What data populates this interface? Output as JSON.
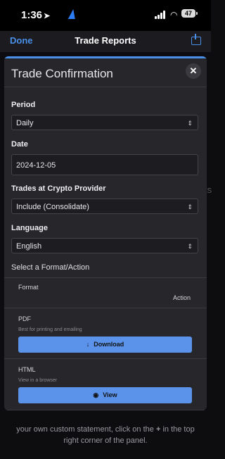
{
  "status": {
    "time": "1:36",
    "battery": "47"
  },
  "nav": {
    "done": "Done",
    "title": "Trade Reports"
  },
  "background": {
    "line1": "your own custom statement, click on the",
    "plus": "+",
    "line1_end": "in the top",
    "line2": "right corner of the panel.",
    "side_fragment": "ts"
  },
  "modal": {
    "title": "Trade Confirmation",
    "close": "✕",
    "period_label": "Period",
    "period_value": "Daily",
    "date_label": "Date",
    "date_value": "2024-12-05",
    "crypto_label": "Trades at Crypto Provider",
    "crypto_value": "Include (Consolidate)",
    "language_label": "Language",
    "language_value": "English",
    "format_section": "Select a Format/Action",
    "format_header": "Format",
    "action_header": "Action",
    "formats": [
      {
        "name": "PDF",
        "desc": "Best for printing and emailing",
        "action": "Download",
        "icon": "download-icon"
      },
      {
        "name": "HTML",
        "desc": "View in a browser",
        "action": "View",
        "icon": "eye-icon"
      }
    ]
  },
  "colors": {
    "accent": "#4a8fe8",
    "button": "#5b93ea",
    "panel": "#26262b"
  }
}
